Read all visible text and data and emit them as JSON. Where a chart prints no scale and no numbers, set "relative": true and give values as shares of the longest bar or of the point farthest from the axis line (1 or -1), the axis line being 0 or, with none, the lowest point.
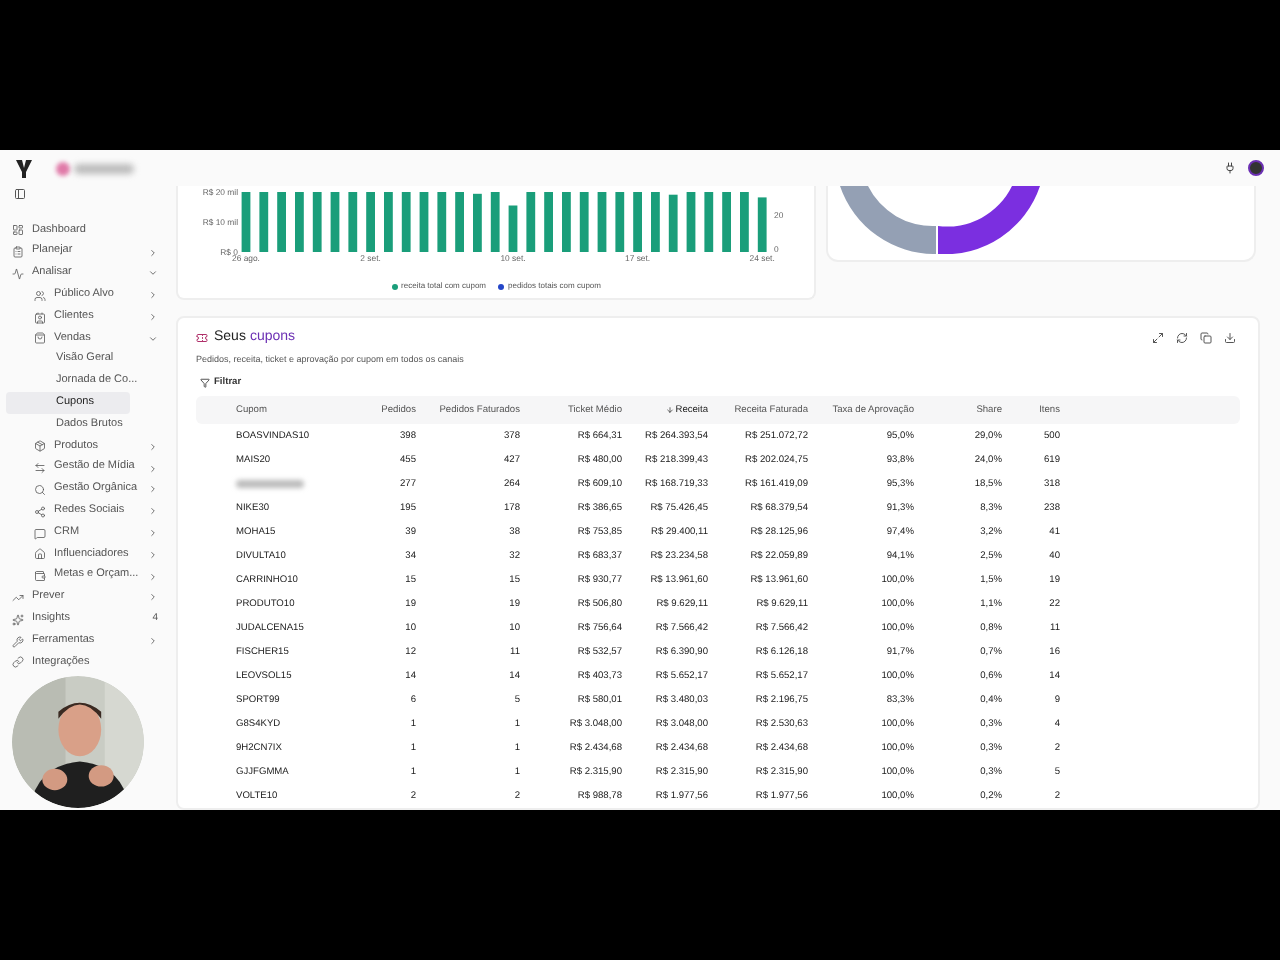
{
  "sidebar": {
    "items": [
      {
        "label": "Dashboard",
        "selected": false
      },
      {
        "label": "Planejar",
        "selected": false,
        "expanded": false
      },
      {
        "label": "Analisar",
        "selected": false,
        "expanded": true,
        "children": [
          {
            "label": "Público Alvo",
            "selected": false,
            "expanded": false
          },
          {
            "label": "Clientes",
            "selected": false,
            "expanded": false
          },
          {
            "label": "Vendas",
            "selected": false,
            "expanded": true,
            "children": [
              {
                "label": "Visão Geral",
                "selected": false
              },
              {
                "label": "Jornada de Co...",
                "selected": false
              },
              {
                "label": "Cupons",
                "selected": true
              },
              {
                "label": "Dados Brutos",
                "selected": false
              }
            ]
          },
          {
            "label": "Produtos",
            "selected": false,
            "expanded": false
          },
          {
            "label": "Gestão de Mídia",
            "selected": false,
            "expanded": false
          },
          {
            "label": "Gestão Orgânica",
            "selected": false,
            "expanded": false
          },
          {
            "label": "Redes Sociais",
            "selected": false,
            "expanded": false
          },
          {
            "label": "CRM",
            "selected": false,
            "expanded": false
          },
          {
            "label": "Influenciadores",
            "selected": false,
            "expanded": false
          },
          {
            "label": "Metas e Orçam...",
            "selected": false,
            "expanded": false
          }
        ]
      },
      {
        "label": "Prever",
        "selected": false,
        "expanded": false
      },
      {
        "label": "Insights",
        "selected": false,
        "badge": "4"
      },
      {
        "label": "Ferramentas",
        "selected": false,
        "expanded": false
      },
      {
        "label": "Integrações",
        "selected": false
      }
    ]
  },
  "revenue_chart": {
    "chart_data": {
      "type": "bar",
      "categories": [
        "26 ago.",
        null,
        null,
        null,
        null,
        null,
        null,
        "2 set.",
        null,
        null,
        null,
        null,
        null,
        null,
        null,
        "10 set.",
        null,
        null,
        null,
        null,
        null,
        null,
        "17 set.",
        null,
        null,
        null,
        null,
        null,
        null,
        "24 set."
      ],
      "relative": true,
      "series": [
        {
          "name": "receita total com cupom",
          "color": "#1a9e7a",
          "values": [
            1,
            1,
            1,
            1,
            1,
            1,
            1,
            1,
            1,
            1,
            1,
            1,
            1,
            0.97,
            1,
            0.775,
            1,
            1,
            1,
            1,
            1,
            1,
            1,
            1,
            0.955,
            1,
            1,
            1,
            1,
            0.91
          ]
        }
      ]
    },
    "left_axis_ticks": [
      "R$ 20 mil",
      "R$ 10 mil",
      "R$ 0"
    ],
    "right_axis_ticks": [
      "20",
      "0"
    ],
    "legend": [
      {
        "label": "pedidos totais com cupom",
        "color": "#2446c8"
      }
    ]
  },
  "coupons": {
    "title": "Seus",
    "title_highlight": "cupons",
    "subtitle": "Pedidos, receita, ticket e aprovação por cupom em todos os canais",
    "filter_button": "Filtrar",
    "table": {
      "columns": [
        {
          "label": "Cupom",
          "sorted": false
        },
        {
          "label": "Pedidos",
          "sorted": false
        },
        {
          "label": "Pedidos Faturados",
          "sorted": false
        },
        {
          "label": "Ticket Médio",
          "sorted": false
        },
        {
          "label": "Receita",
          "sorted": true
        },
        {
          "label": "Receita Faturada",
          "sorted": false
        },
        {
          "label": "Taxa de Aprovação",
          "sorted": false
        },
        {
          "label": "Share",
          "sorted": false
        },
        {
          "label": "Itens",
          "sorted": false
        }
      ],
      "rows": [
        {
          "cells": [
            "BOASVINDAS10",
            "398",
            "378",
            "R$ 664,31",
            "R$ 264.393,54",
            "R$ 251.072,72",
            "95,0%",
            "29,0%",
            "500"
          ]
        },
        {
          "cells": [
            "MAIS20",
            "455",
            "427",
            "R$ 480,00",
            "R$ 218.399,43",
            "R$ 202.024,75",
            "93,8%",
            "24,0%",
            "619"
          ]
        },
        {
          "redacted": true,
          "cells": [
            "",
            "277",
            "264",
            "R$ 609,10",
            "R$ 168.719,33",
            "R$ 161.419,09",
            "95,3%",
            "18,5%",
            "318"
          ]
        },
        {
          "cells": [
            "NIKE30",
            "195",
            "178",
            "R$ 386,65",
            "R$ 75.426,45",
            "R$ 68.379,54",
            "91,3%",
            "8,3%",
            "238"
          ]
        },
        {
          "cells": [
            "MOHA15",
            "39",
            "38",
            "R$ 753,85",
            "R$ 29.400,11",
            "R$ 28.125,96",
            "97,4%",
            "3,2%",
            "41"
          ]
        },
        {
          "cells": [
            "DIVULTA10",
            "34",
            "32",
            "R$ 683,37",
            "R$ 23.234,58",
            "R$ 22.059,89",
            "94,1%",
            "2,5%",
            "40"
          ]
        },
        {
          "cells": [
            "CARRINHO10",
            "15",
            "15",
            "R$ 930,77",
            "R$ 13.961,60",
            "R$ 13.961,60",
            "100,0%",
            "1,5%",
            "19"
          ]
        },
        {
          "cells": [
            "PRODUTO10",
            "19",
            "19",
            "R$ 506,80",
            "R$ 9.629,11",
            "R$ 9.629,11",
            "100,0%",
            "1,1%",
            "22"
          ]
        },
        {
          "cells": [
            "JUDALCENA15",
            "10",
            "10",
            "R$ 756,64",
            "R$ 7.566,42",
            "R$ 7.566,42",
            "100,0%",
            "0,8%",
            "11"
          ]
        },
        {
          "cells": [
            "FISCHER15",
            "12",
            "11",
            "R$ 532,57",
            "R$ 6.390,90",
            "R$ 6.126,18",
            "91,7%",
            "0,7%",
            "16"
          ]
        },
        {
          "cells": [
            "LEOVSOL15",
            "14",
            "14",
            "R$ 403,73",
            "R$ 5.652,17",
            "R$ 5.652,17",
            "100,0%",
            "0,6%",
            "14"
          ]
        },
        {
          "cells": [
            "SPORT99",
            "6",
            "5",
            "R$ 580,01",
            "R$ 3.480,03",
            "R$ 2.196,75",
            "83,3%",
            "0,4%",
            "9"
          ]
        },
        {
          "cells": [
            "G8S4KYD",
            "1",
            "1",
            "R$ 3.048,00",
            "R$ 3.048,00",
            "R$ 2.530,63",
            "100,0%",
            "0,3%",
            "4"
          ]
        },
        {
          "cells": [
            "9H2CN7IX",
            "1",
            "1",
            "R$ 2.434,68",
            "R$ 2.434,68",
            "R$ 2.434,68",
            "100,0%",
            "0,3%",
            "2"
          ]
        },
        {
          "cells": [
            "GJJFGMMA",
            "1",
            "1",
            "R$ 2.315,90",
            "R$ 2.315,90",
            "R$ 2.315,90",
            "100,0%",
            "0,3%",
            "5"
          ]
        },
        {
          "cells": [
            "VOLTE10",
            "2",
            "2",
            "R$ 988,78",
            "R$ 1.977,56",
            "R$ 1.977,56",
            "100,0%",
            "0,2%",
            "2"
          ]
        }
      ]
    }
  }
}
